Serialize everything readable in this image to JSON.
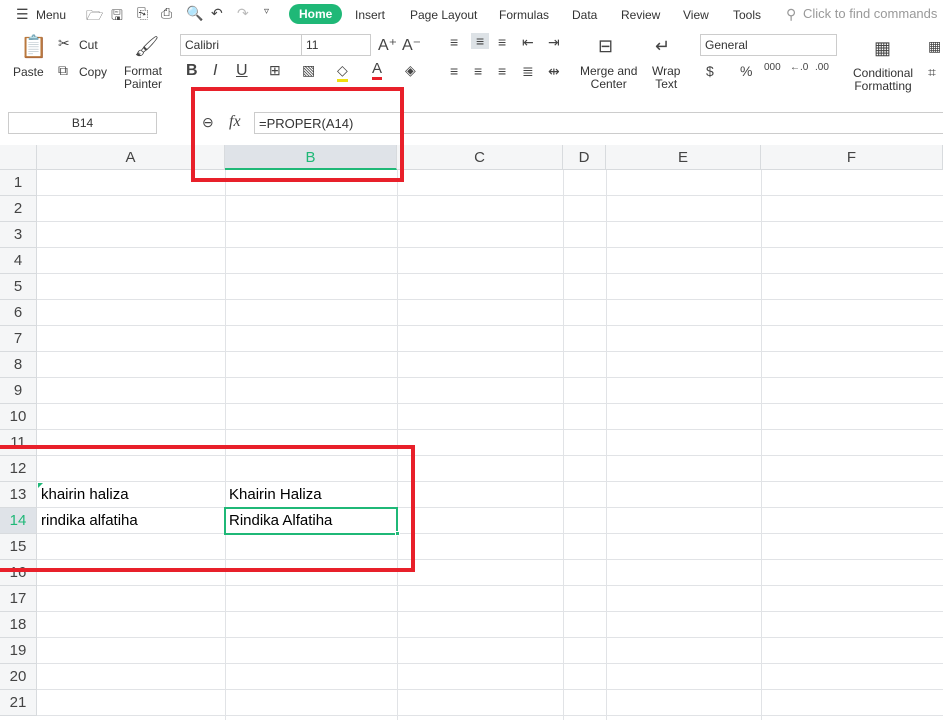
{
  "menu": {
    "label": "Menu"
  },
  "tabs": [
    "Home",
    "Insert",
    "Page Layout",
    "Formulas",
    "Data",
    "Review",
    "View",
    "Tools"
  ],
  "search": {
    "placeholder": "Click to find commands"
  },
  "ribbon": {
    "paste": "Paste",
    "cut": "Cut",
    "copy": "Copy",
    "format_painter_1": "Format",
    "format_painter_2": "Painter",
    "font": "Calibri",
    "size": "11",
    "merge_1": "Merge and",
    "merge_2": "Center",
    "wrap_1": "Wrap",
    "wrap_2": "Text",
    "number_format": "General",
    "cond_1": "Conditional",
    "cond_2": "Formatting"
  },
  "formula_bar": {
    "cell_ref": "B14",
    "fx": "fx",
    "formula": "=PROPER(A14)"
  },
  "columns": [
    "A",
    "B",
    "C",
    "D",
    "E",
    "F"
  ],
  "rows": [
    "1",
    "2",
    "3",
    "4",
    "5",
    "6",
    "7",
    "8",
    "9",
    "10",
    "11",
    "12",
    "13",
    "14",
    "15",
    "16",
    "17",
    "18",
    "19",
    "20",
    "21"
  ],
  "cells": {
    "A13": "khairin haliza",
    "B13": "Khairin Haliza",
    "A14": "rindika alfatiha",
    "B14": "Rindika Alfatiha"
  },
  "active_cell": "B14",
  "accent": "#1fb877",
  "highlight_color": "#e8202a"
}
